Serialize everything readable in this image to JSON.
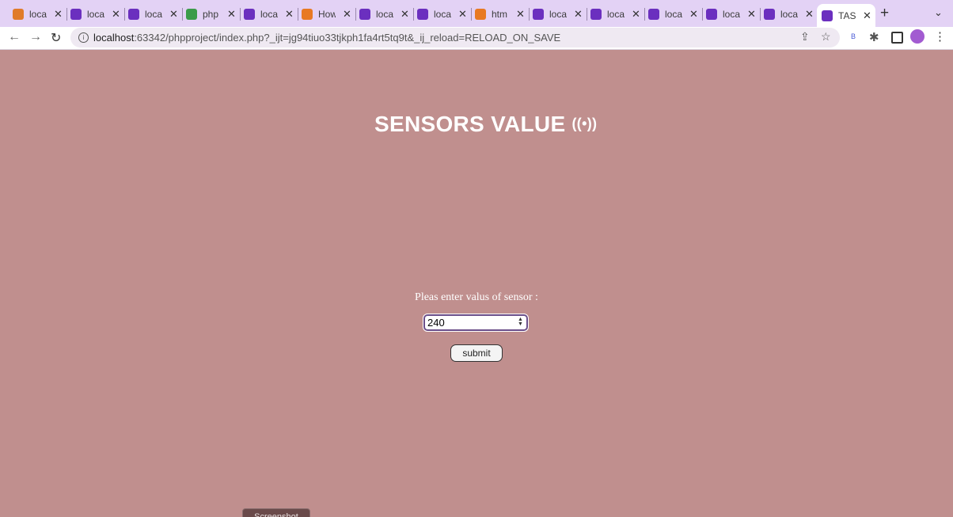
{
  "tabs": [
    {
      "label": "loca",
      "icon": "pma-icon",
      "color": "#e07b2a"
    },
    {
      "label": "loca",
      "icon": "phpstorm-icon",
      "color": "#6b2fbf"
    },
    {
      "label": "loca",
      "icon": "phpstorm-icon",
      "color": "#6b2fbf"
    },
    {
      "label": "php",
      "icon": "tools-icon",
      "color": "#3b9b4a"
    },
    {
      "label": "loca",
      "icon": "phpstorm-icon",
      "color": "#6b2fbf"
    },
    {
      "label": "How",
      "icon": "stackoverflow-icon",
      "color": "#e87922"
    },
    {
      "label": "loca",
      "icon": "phpstorm-icon",
      "color": "#6b2fbf"
    },
    {
      "label": "loca",
      "icon": "phpstorm-icon",
      "color": "#6b2fbf"
    },
    {
      "label": "htm",
      "icon": "stackoverflow-icon",
      "color": "#e87922"
    },
    {
      "label": "loca",
      "icon": "phpstorm-icon",
      "color": "#6b2fbf"
    },
    {
      "label": "loca",
      "icon": "phpstorm-icon",
      "color": "#6b2fbf"
    },
    {
      "label": "loca",
      "icon": "phpstorm-icon",
      "color": "#6b2fbf"
    },
    {
      "label": "loca",
      "icon": "phpstorm-icon",
      "color": "#6b2fbf"
    },
    {
      "label": "loca",
      "icon": "phpstorm-icon",
      "color": "#6b2fbf"
    },
    {
      "label": "TAS",
      "icon": "phpstorm-icon",
      "color": "#6b2fbf",
      "active": true
    }
  ],
  "address_bar": {
    "host": "localhost",
    "path": ":63342/phpproject/index.php?_ijt=jg94tiuo33tjkph1fa4rt5tq9t&_ij_reload=RELOAD_ON_SAVE"
  },
  "page": {
    "title": "SENSORS VALUE",
    "title_icon": "((•))",
    "prompt": "Pleas enter valus of sensor :",
    "input_value": "240",
    "submit_label": "submit",
    "screenshot_label": "Screenshot",
    "background_color": "#c08f8e"
  }
}
